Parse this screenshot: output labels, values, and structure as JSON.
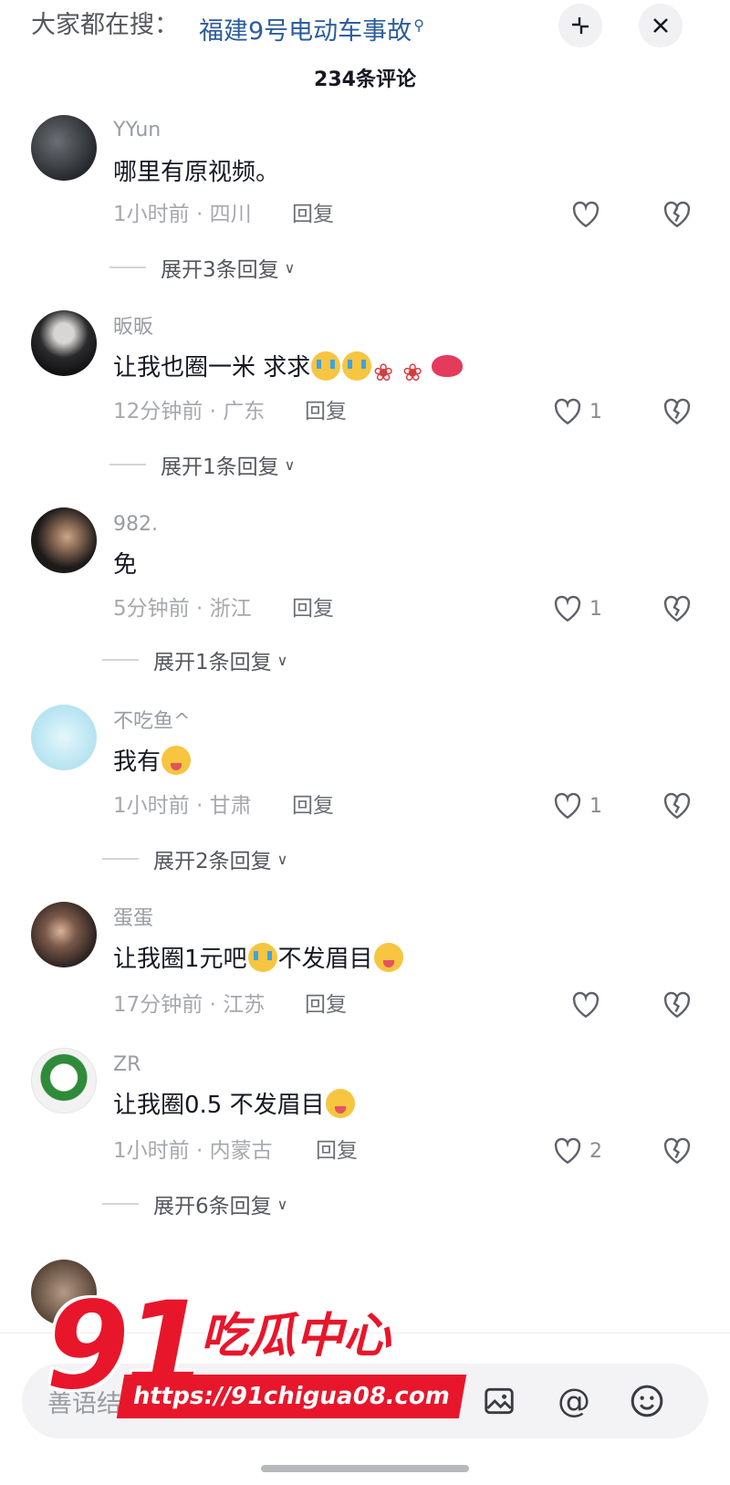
{
  "search": {
    "prefix": "大家都在搜：",
    "term": "福建9号电动车事故",
    "term_icon": "search-icon"
  },
  "header": {
    "minimize_icon": "collapse-icon",
    "close_icon": "close-icon",
    "comment_count": "234条评论"
  },
  "comments": [
    {
      "username": "YYun",
      "text": "哪里有原视频。",
      "emojis": [],
      "time": "1小时前",
      "location": "四川",
      "reply_label": "回复",
      "likes": "",
      "expand_label": "展开3条回复"
    },
    {
      "username": "昄昄",
      "text": "让我也圈一米 求求",
      "emojis": [
        "cry",
        "cry",
        "rose",
        "rose",
        "lips"
      ],
      "time": "12分钟前",
      "location": "广东",
      "reply_label": "回复",
      "likes": "1",
      "expand_label": "展开1条回复"
    },
    {
      "username": "982.",
      "text": "免",
      "emojis": [],
      "time": "5分钟前",
      "location": "浙江",
      "reply_label": "回复",
      "likes": "1",
      "expand_label": "展开1条回复"
    },
    {
      "username": "不吃鱼^",
      "text": "我有",
      "emojis": [
        "silly"
      ],
      "time": "1小时前",
      "location": "甘肃",
      "reply_label": "回复",
      "likes": "1",
      "expand_label": "展开2条回复"
    },
    {
      "username": "蛋蛋",
      "text_a": "让我圈1元吧",
      "text_b": "不发眉目",
      "time": "17分钟前",
      "location": "江苏",
      "reply_label": "回复",
      "likes": "",
      "expand_label": ""
    },
    {
      "username": "ZR",
      "text": "让我圈0.5 不发眉目",
      "emojis": [
        "silly"
      ],
      "time": "1小时前",
      "location": "内蒙古",
      "reply_label": "回复",
      "likes": "2",
      "expand_label": "展开6条回复"
    }
  ],
  "meta_separator": " · ",
  "input": {
    "placeholder": "善语结",
    "image_icon": "image-icon",
    "mention_label": "@",
    "emoji_icon": "emoji-icon"
  },
  "watermark": {
    "logo_number": "91",
    "name": "吃瓜中心",
    "url": "https://91chigua08.com"
  },
  "colors": {
    "link": "#2b5d9c",
    "muted": "#a7a8ae",
    "watermark_red": "#e8162b"
  }
}
